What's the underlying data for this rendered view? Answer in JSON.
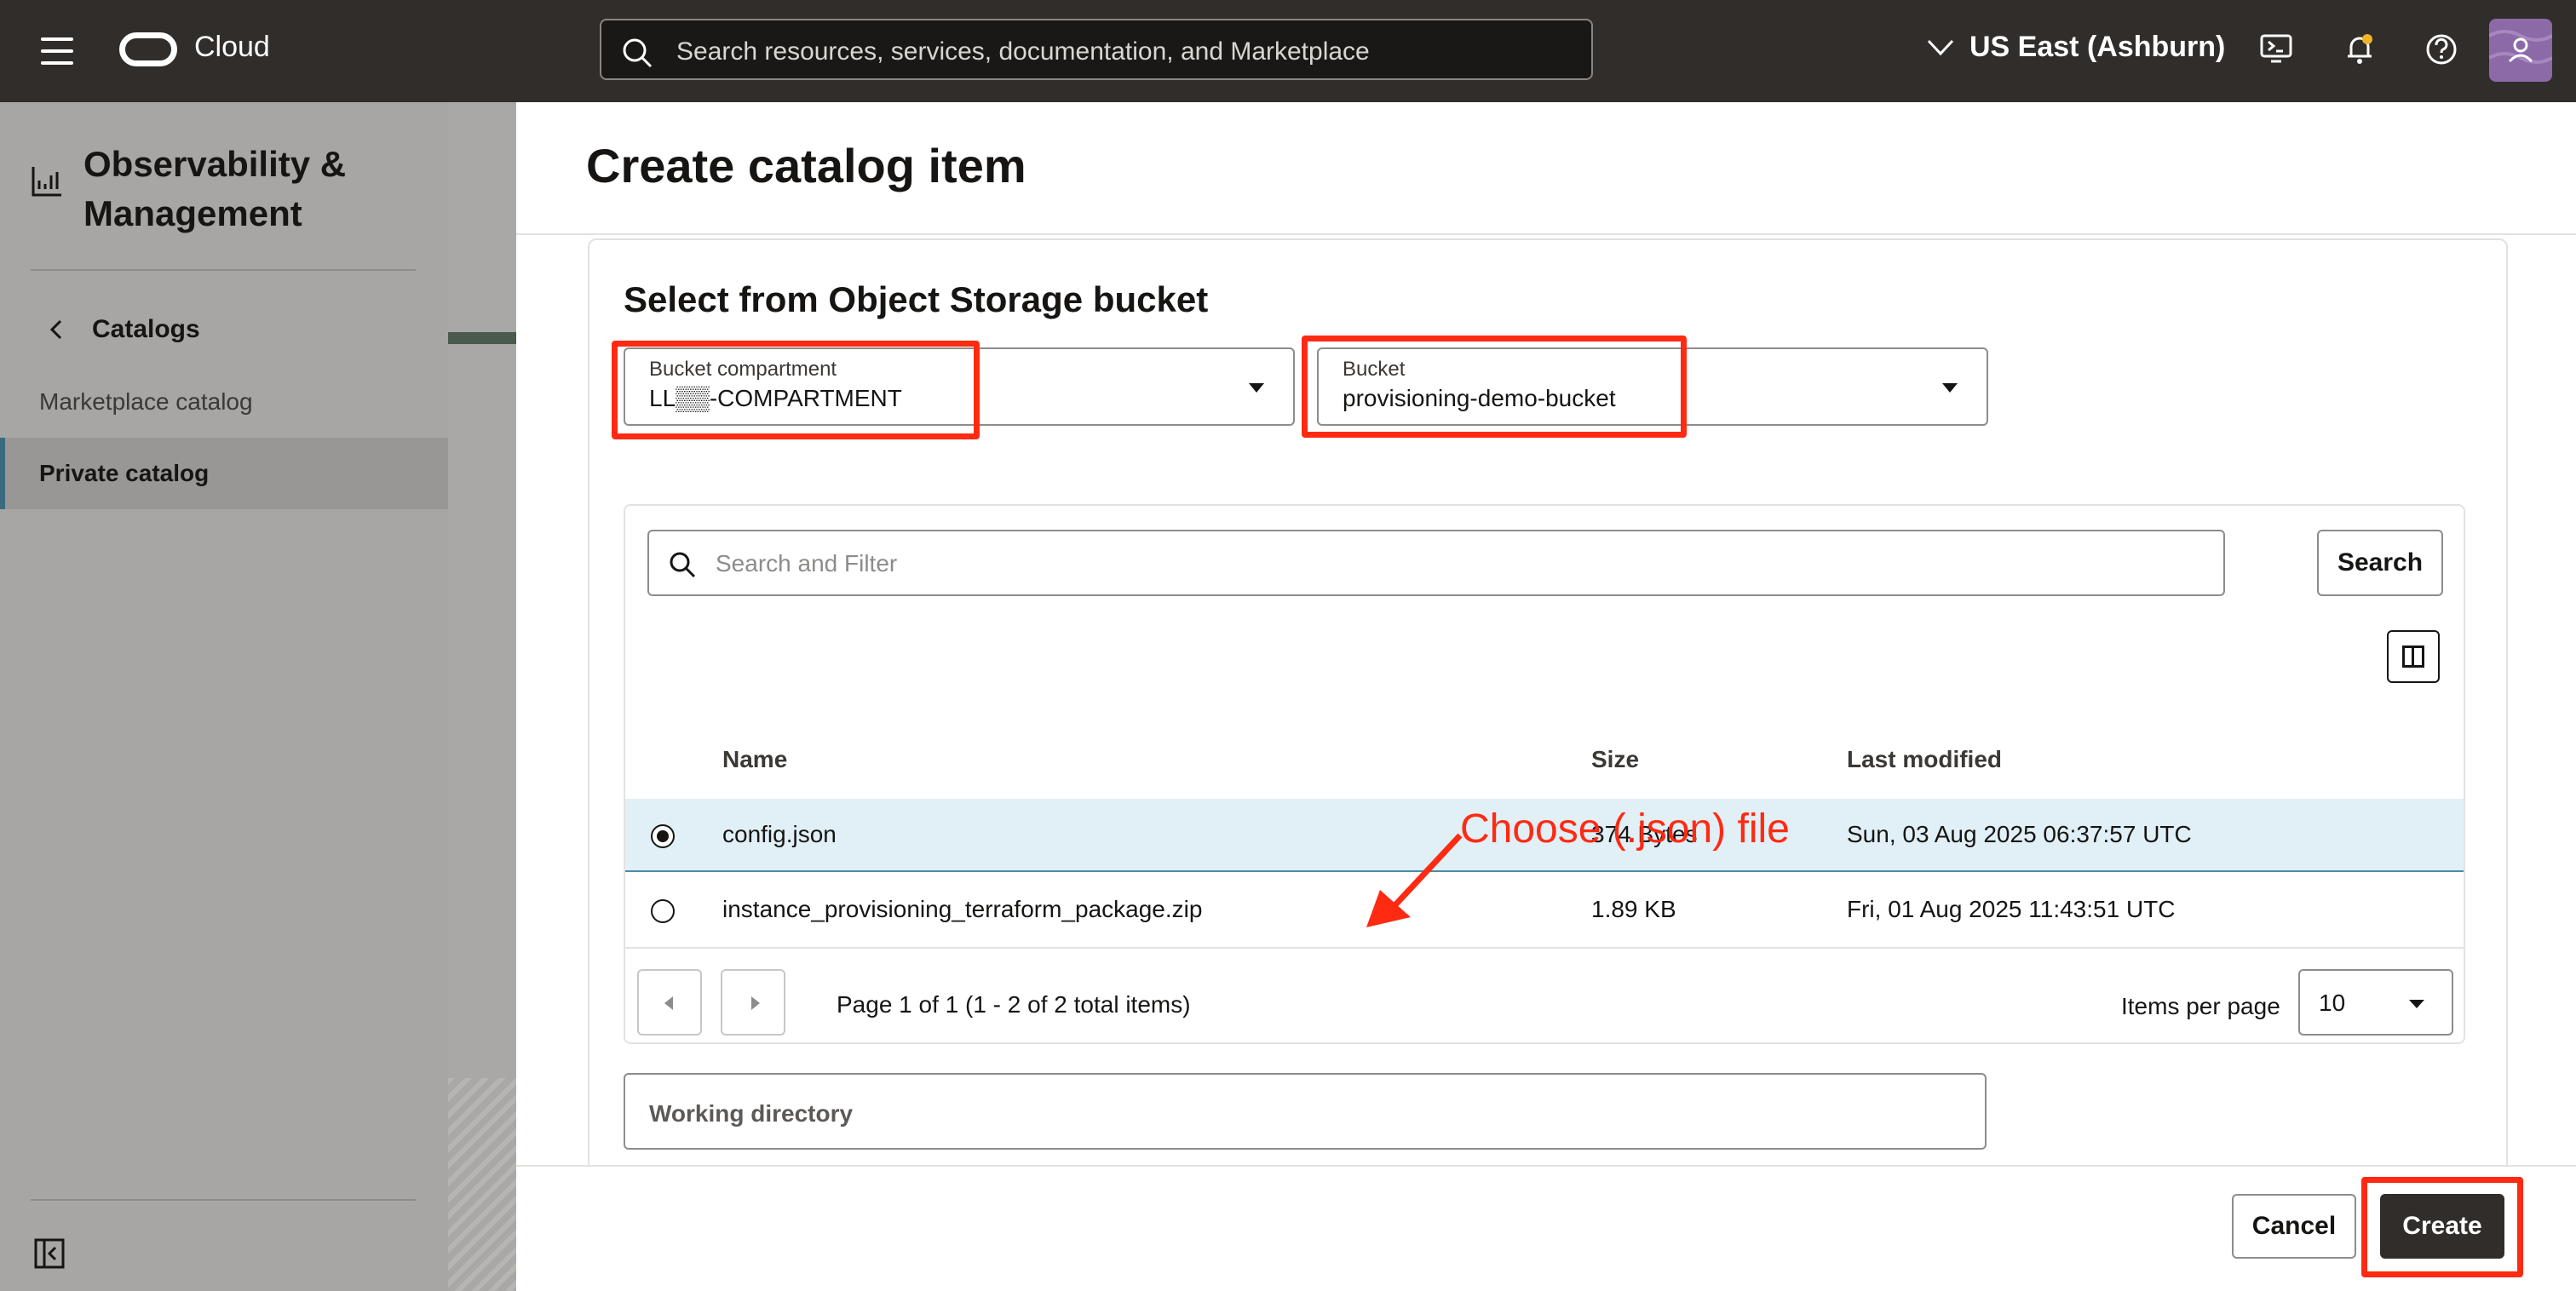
{
  "topbar": {
    "brand": "Cloud",
    "search_placeholder": "Search resources, services, documentation, and Marketplace",
    "region": "US East (Ashburn)",
    "icons": [
      "menu-icon",
      "oracle-logo-icon",
      "search-icon",
      "chevron-down-icon",
      "cloud-shell-icon",
      "bell-icon",
      "help-icon",
      "avatar"
    ]
  },
  "sidebar": {
    "title": "Observability & Management",
    "back_label": "Catalogs",
    "items": [
      {
        "label": "Marketplace catalog",
        "active": false
      },
      {
        "label": "Private catalog",
        "active": true
      }
    ]
  },
  "panel": {
    "title": "Create catalog item",
    "section_title": "Select from Object Storage bucket",
    "bucket_compartment": {
      "label": "Bucket compartment",
      "value": "LL▒▒-COMPARTMENT"
    },
    "bucket": {
      "label": "Bucket",
      "value": "provisioning-demo-bucket"
    },
    "filter_placeholder": "Search and Filter",
    "search_button": "Search",
    "table": {
      "columns": [
        "Name",
        "Size",
        "Last modified"
      ],
      "rows": [
        {
          "name": "config.json",
          "size": "374 Bytes",
          "modified": "Sun, 03 Aug 2025 06:37:57 UTC",
          "selected": true
        },
        {
          "name": "instance_provisioning_terraform_package.zip",
          "size": "1.89 KB",
          "modified": "Fri, 01 Aug 2025 11:43:51 UTC",
          "selected": false
        }
      ]
    },
    "pagination": {
      "text": "Page 1 of 1 (1 - 2 of 2 total items)",
      "items_per_page_label": "Items per page",
      "items_per_page": "10"
    },
    "working_directory_placeholder": "Working directory",
    "cancel_button": "Cancel",
    "create_button": "Create"
  },
  "annotation": {
    "text": "Choose (.json) file",
    "color": "#ff2a12"
  },
  "colors": {
    "topbar": "#312d2a",
    "highlight": "#ff2a12",
    "selected_row": "#e1eff6",
    "primary_button": "#312d2a"
  }
}
